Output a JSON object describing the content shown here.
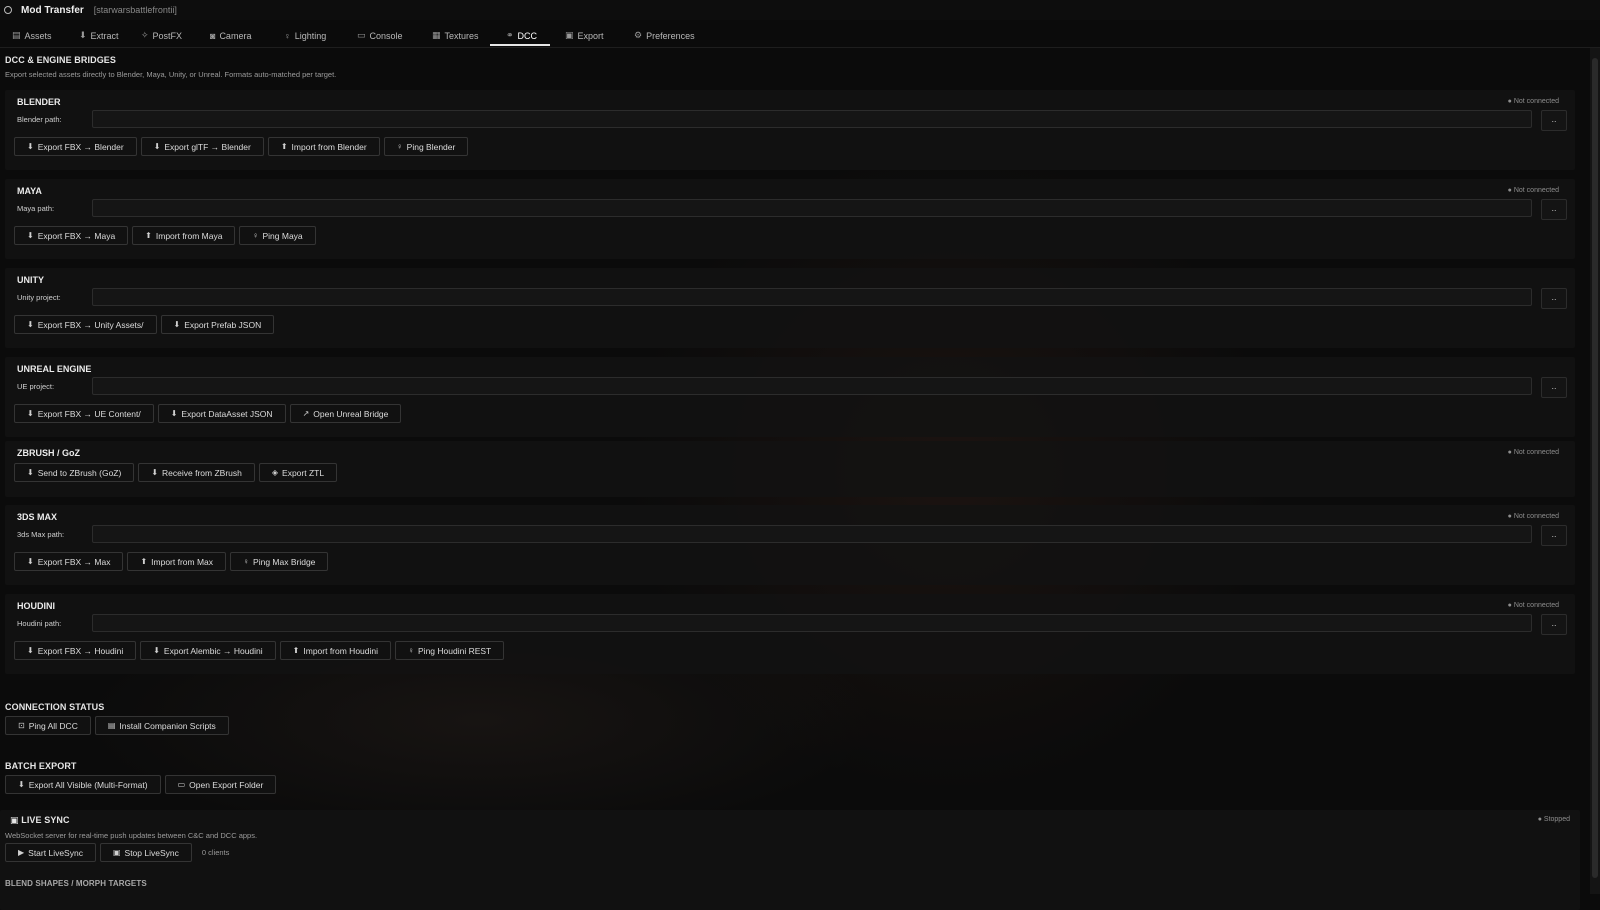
{
  "window": {
    "app_title": "Mod Transfer",
    "project": "[starwarsbattlefrontii]"
  },
  "tabs": [
    {
      "label": "Assets",
      "icon": "assets-icon",
      "glyph": "▤"
    },
    {
      "label": "Extract",
      "icon": "extract-icon",
      "glyph": "⬇"
    },
    {
      "label": "PostFX",
      "icon": "postfx-icon",
      "glyph": "✧"
    },
    {
      "label": "Camera",
      "icon": "camera-icon",
      "glyph": "◙"
    },
    {
      "label": "Lighting",
      "icon": "lighting-icon",
      "glyph": "♀"
    },
    {
      "label": "Console",
      "icon": "console-icon",
      "glyph": "▭"
    },
    {
      "label": "Textures",
      "icon": "textures-icon",
      "glyph": "▦"
    },
    {
      "label": "DCC",
      "icon": "link-icon",
      "glyph": "⚭"
    },
    {
      "label": "Export",
      "icon": "export-icon",
      "glyph": "▣"
    },
    {
      "label": "Preferences",
      "icon": "gear-icon",
      "glyph": "⚙"
    }
  ],
  "active_tab": "DCC",
  "header": {
    "title": "DCC & ENGINE BRIDGES",
    "subtitle": "Export selected assets directly to Blender, Maya, Unity, or Unreal. Formats auto-matched per target."
  },
  "bridges": [
    {
      "title": "BLENDER",
      "status": "● Not connected",
      "path_label": "Blender path:",
      "path_value": "",
      "buttons": [
        {
          "glyph": "⬇",
          "label": "Export FBX → Blender"
        },
        {
          "glyph": "⬇",
          "label": "Export glTF → Blender"
        },
        {
          "glyph": "⬆",
          "label": "Import from Blender"
        },
        {
          "glyph": "♀",
          "label": "Ping Blender"
        }
      ]
    },
    {
      "title": "MAYA",
      "status": "● Not connected",
      "path_label": "Maya path:",
      "path_value": "",
      "buttons": [
        {
          "glyph": "⬇",
          "label": "Export FBX → Maya"
        },
        {
          "glyph": "⬆",
          "label": "Import from Maya"
        },
        {
          "glyph": "♀",
          "label": "Ping Maya"
        }
      ]
    },
    {
      "title": "UNITY",
      "status": "",
      "path_label": "Unity project:",
      "path_value": "",
      "buttons": [
        {
          "glyph": "⬇",
          "label": "Export FBX → Unity Assets/"
        },
        {
          "glyph": "⬇",
          "label": "Export Prefab JSON"
        }
      ]
    },
    {
      "title": "UNREAL ENGINE",
      "status": "",
      "path_label": "UE project:",
      "path_value": "",
      "buttons": [
        {
          "glyph": "⬇",
          "label": "Export FBX → UE Content/"
        },
        {
          "glyph": "⬇",
          "label": "Export DataAsset JSON"
        },
        {
          "glyph": "↗",
          "label": "Open Unreal Bridge"
        }
      ]
    },
    {
      "title": "ZBRUSH / GoZ",
      "status": "● Not connected",
      "path_label": "",
      "path_value": "",
      "buttons": [
        {
          "glyph": "⬇",
          "label": "Send to ZBrush (GoZ)"
        },
        {
          "glyph": "⬇",
          "label": "Receive from ZBrush"
        },
        {
          "glyph": "◈",
          "label": "Export ZTL"
        }
      ]
    },
    {
      "title": "3DS MAX",
      "status": "● Not connected",
      "path_label": "3ds Max path:",
      "path_value": "",
      "buttons": [
        {
          "glyph": "⬇",
          "label": "Export FBX → Max"
        },
        {
          "glyph": "⬆",
          "label": "Import from Max"
        },
        {
          "glyph": "♀",
          "label": "Ping Max Bridge"
        }
      ]
    },
    {
      "title": "HOUDINI",
      "status": "● Not connected",
      "path_label": "Houdini path:",
      "path_value": "",
      "buttons": [
        {
          "glyph": "⬇",
          "label": "Export FBX → Houdini"
        },
        {
          "glyph": "⬇",
          "label": "Export Alembic → Houdini"
        },
        {
          "glyph": "⬆",
          "label": "Import from Houdini"
        },
        {
          "glyph": "♀",
          "label": "Ping Houdini REST"
        }
      ]
    }
  ],
  "browse_label": "..",
  "connection_status": {
    "title": "CONNECTION STATUS",
    "buttons": [
      {
        "glyph": "⊡",
        "label": "Ping All DCC"
      },
      {
        "glyph": "▤",
        "label": "Install Companion Scripts"
      }
    ]
  },
  "batch_export": {
    "title": "BATCH EXPORT",
    "buttons": [
      {
        "glyph": "⬇",
        "label": "Export All Visible (Multi-Format)"
      },
      {
        "glyph": "▭",
        "label": "Open Export Folder"
      }
    ]
  },
  "live_sync": {
    "title": "LIVE SYNC",
    "status": "● Stopped",
    "subtitle": "WebSocket server for real-time push updates between C&C and DCC apps.",
    "buttons": [
      {
        "glyph": "▶",
        "label": "Start LiveSync"
      },
      {
        "glyph": "▣",
        "label": "Stop LiveSync"
      }
    ],
    "clients": "0 clients"
  },
  "next_section_title": "BLEND SHAPES / MORPH TARGETS"
}
